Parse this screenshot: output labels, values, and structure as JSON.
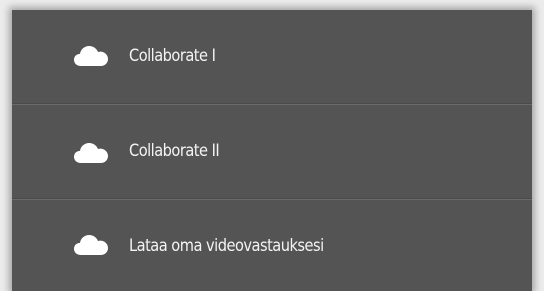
{
  "menu": {
    "items": [
      {
        "label": "Collaborate I",
        "icon": "cloud-icon"
      },
      {
        "label": "Collaborate II",
        "icon": "cloud-icon"
      },
      {
        "label": "Lataa oma videovastauksesi",
        "icon": "cloud-icon"
      }
    ]
  },
  "colors": {
    "menu_background": "#545454",
    "text": "#f4f4f4",
    "icon": "#ffffff",
    "divider": "#6a6a6a"
  }
}
